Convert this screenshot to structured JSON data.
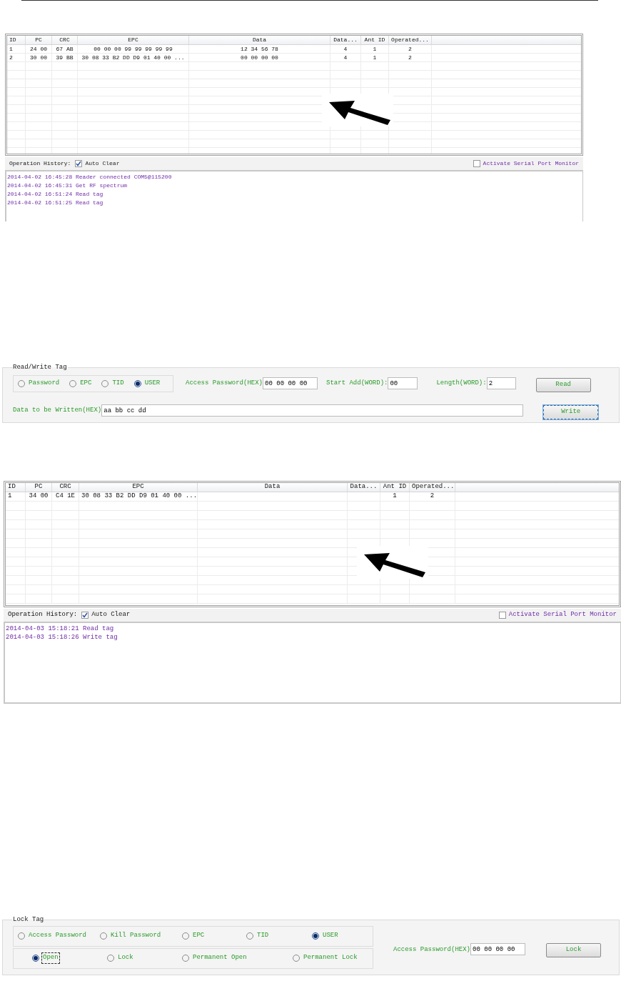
{
  "sections": [
    {
      "kind": "tag_list",
      "table": {
        "columns": [
          "ID",
          "PC",
          "CRC",
          "EPC",
          "Data",
          "Data...",
          "Ant ID",
          "Operated..."
        ],
        "rows": [
          [
            "1",
            "24 00",
            "67 AB",
            "00 00 00 99 99 99 99 99",
            "12 34 56 78",
            "4",
            "1",
            "2"
          ],
          [
            "2",
            "30 00",
            "39 BB",
            "30 08 33 B2 DD D9 01 40 00 ...",
            "00 00 00 00",
            "4",
            "1",
            "2"
          ]
        ]
      },
      "history": {
        "label": "Operation History:",
        "auto_clear": {
          "label": "Auto Clear",
          "checked": true
        },
        "serial_monitor": {
          "label": "Activate Serial Port Monitor",
          "checked": false
        }
      },
      "log": [
        "2014-04-02 16:45:28 Reader connected COM5@115200",
        "2014-04-02 16:45:31 Get RF spectrum",
        "2014-04-02 16:51:24 Read tag",
        "2014-04-02 16:51:25 Read tag"
      ]
    },
    {
      "kind": "read_write",
      "title": "Read/Write Tag",
      "memory_bank": [
        {
          "label": "Password",
          "selected": false
        },
        {
          "label": "EPC",
          "selected": false
        },
        {
          "label": "TID",
          "selected": false
        },
        {
          "label": "USER",
          "selected": true
        }
      ],
      "access_password": {
        "label": "Access Password(HEX)",
        "value": "00 00 00 00"
      },
      "start_address": {
        "label": "Start Add(WORD):",
        "value": "00"
      },
      "length": {
        "label": "Length(WORD):",
        "value": "2"
      },
      "data_to_write": {
        "label": "Data to be Written(HEX)",
        "value": "aa bb cc dd"
      },
      "buttons": [
        {
          "label": "Read",
          "focused": false
        },
        {
          "label": "Write",
          "focused": true
        }
      ]
    },
    {
      "kind": "tag_list",
      "table": {
        "columns": [
          "ID",
          "PC",
          "CRC",
          "EPC",
          "Data",
          "Data...",
          "Ant ID",
          "Operated..."
        ],
        "rows": [
          [
            "1",
            "34 00",
            "C4 1E",
            "30 08 33 B2 DD D9 01 40 00 ...",
            null,
            null,
            "1",
            "2"
          ]
        ]
      },
      "history": {
        "label": "Operation History:",
        "auto_clear": {
          "label": "Auto Clear",
          "checked": true
        },
        "serial_monitor": {
          "label": "Activate Serial Port Monitor",
          "checked": false
        }
      },
      "log": [
        "2014-04-03 15:18:21 Read tag",
        "2014-04-03 15:18:26 Write tag"
      ]
    },
    {
      "kind": "lock",
      "title": "Lock Tag",
      "memory_bank": [
        {
          "label": "Access Password",
          "selected": false
        },
        {
          "label": "Kill Password",
          "selected": false
        },
        {
          "label": "EPC",
          "selected": false
        },
        {
          "label": "TID",
          "selected": false
        },
        {
          "label": "USER",
          "selected": true
        }
      ],
      "lock_action": [
        {
          "label": "Open",
          "selected": true,
          "focused": true
        },
        {
          "label": "Lock",
          "selected": false,
          "focused": false
        },
        {
          "label": "Permanent Open",
          "selected": false,
          "focused": false
        },
        {
          "label": "Permanent Lock",
          "selected": false,
          "focused": false
        }
      ],
      "access_password": {
        "label": "Access Password(HEX)",
        "value": "00 00 00 00"
      },
      "button": {
        "label": "Lock",
        "focused": false
      }
    }
  ]
}
